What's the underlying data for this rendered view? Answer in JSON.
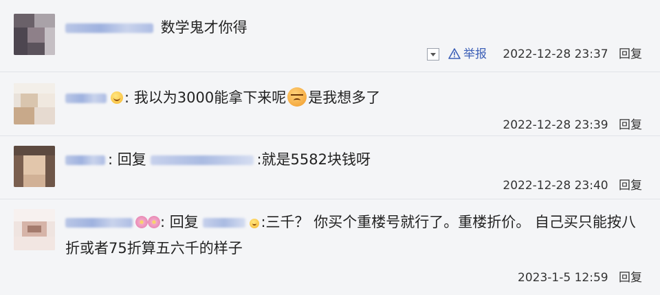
{
  "comments": [
    {
      "text": "数学鬼才你得",
      "time": "2022-12-28 23:37",
      "reply": "回复",
      "report": "举报"
    },
    {
      "text_before": ": 我以为3000能拿下来呢",
      "text_after": "是我想多了",
      "time": "2022-12-28 23:39",
      "reply": "回复"
    },
    {
      "reply_word": "回复",
      "text": ":就是5582块钱呀",
      "time": "2022-12-28 23:40",
      "reply": "回复"
    },
    {
      "reply_word": "回复",
      "text": ":三千？  你买个重楼号就行了。重楼折价。  自己买只能按八折或者75折算五六千的样子",
      "time": "2023-1-5 12:59",
      "reply": "回复"
    }
  ],
  "colors": {
    "link": "#3c5fb7",
    "background": "#f4f5f7",
    "divider": "#e1e3e8"
  },
  "icons": [
    "chevron-down-icon",
    "warning-icon",
    "smile-emoji",
    "unamused-emoji",
    "flower-emoji"
  ]
}
